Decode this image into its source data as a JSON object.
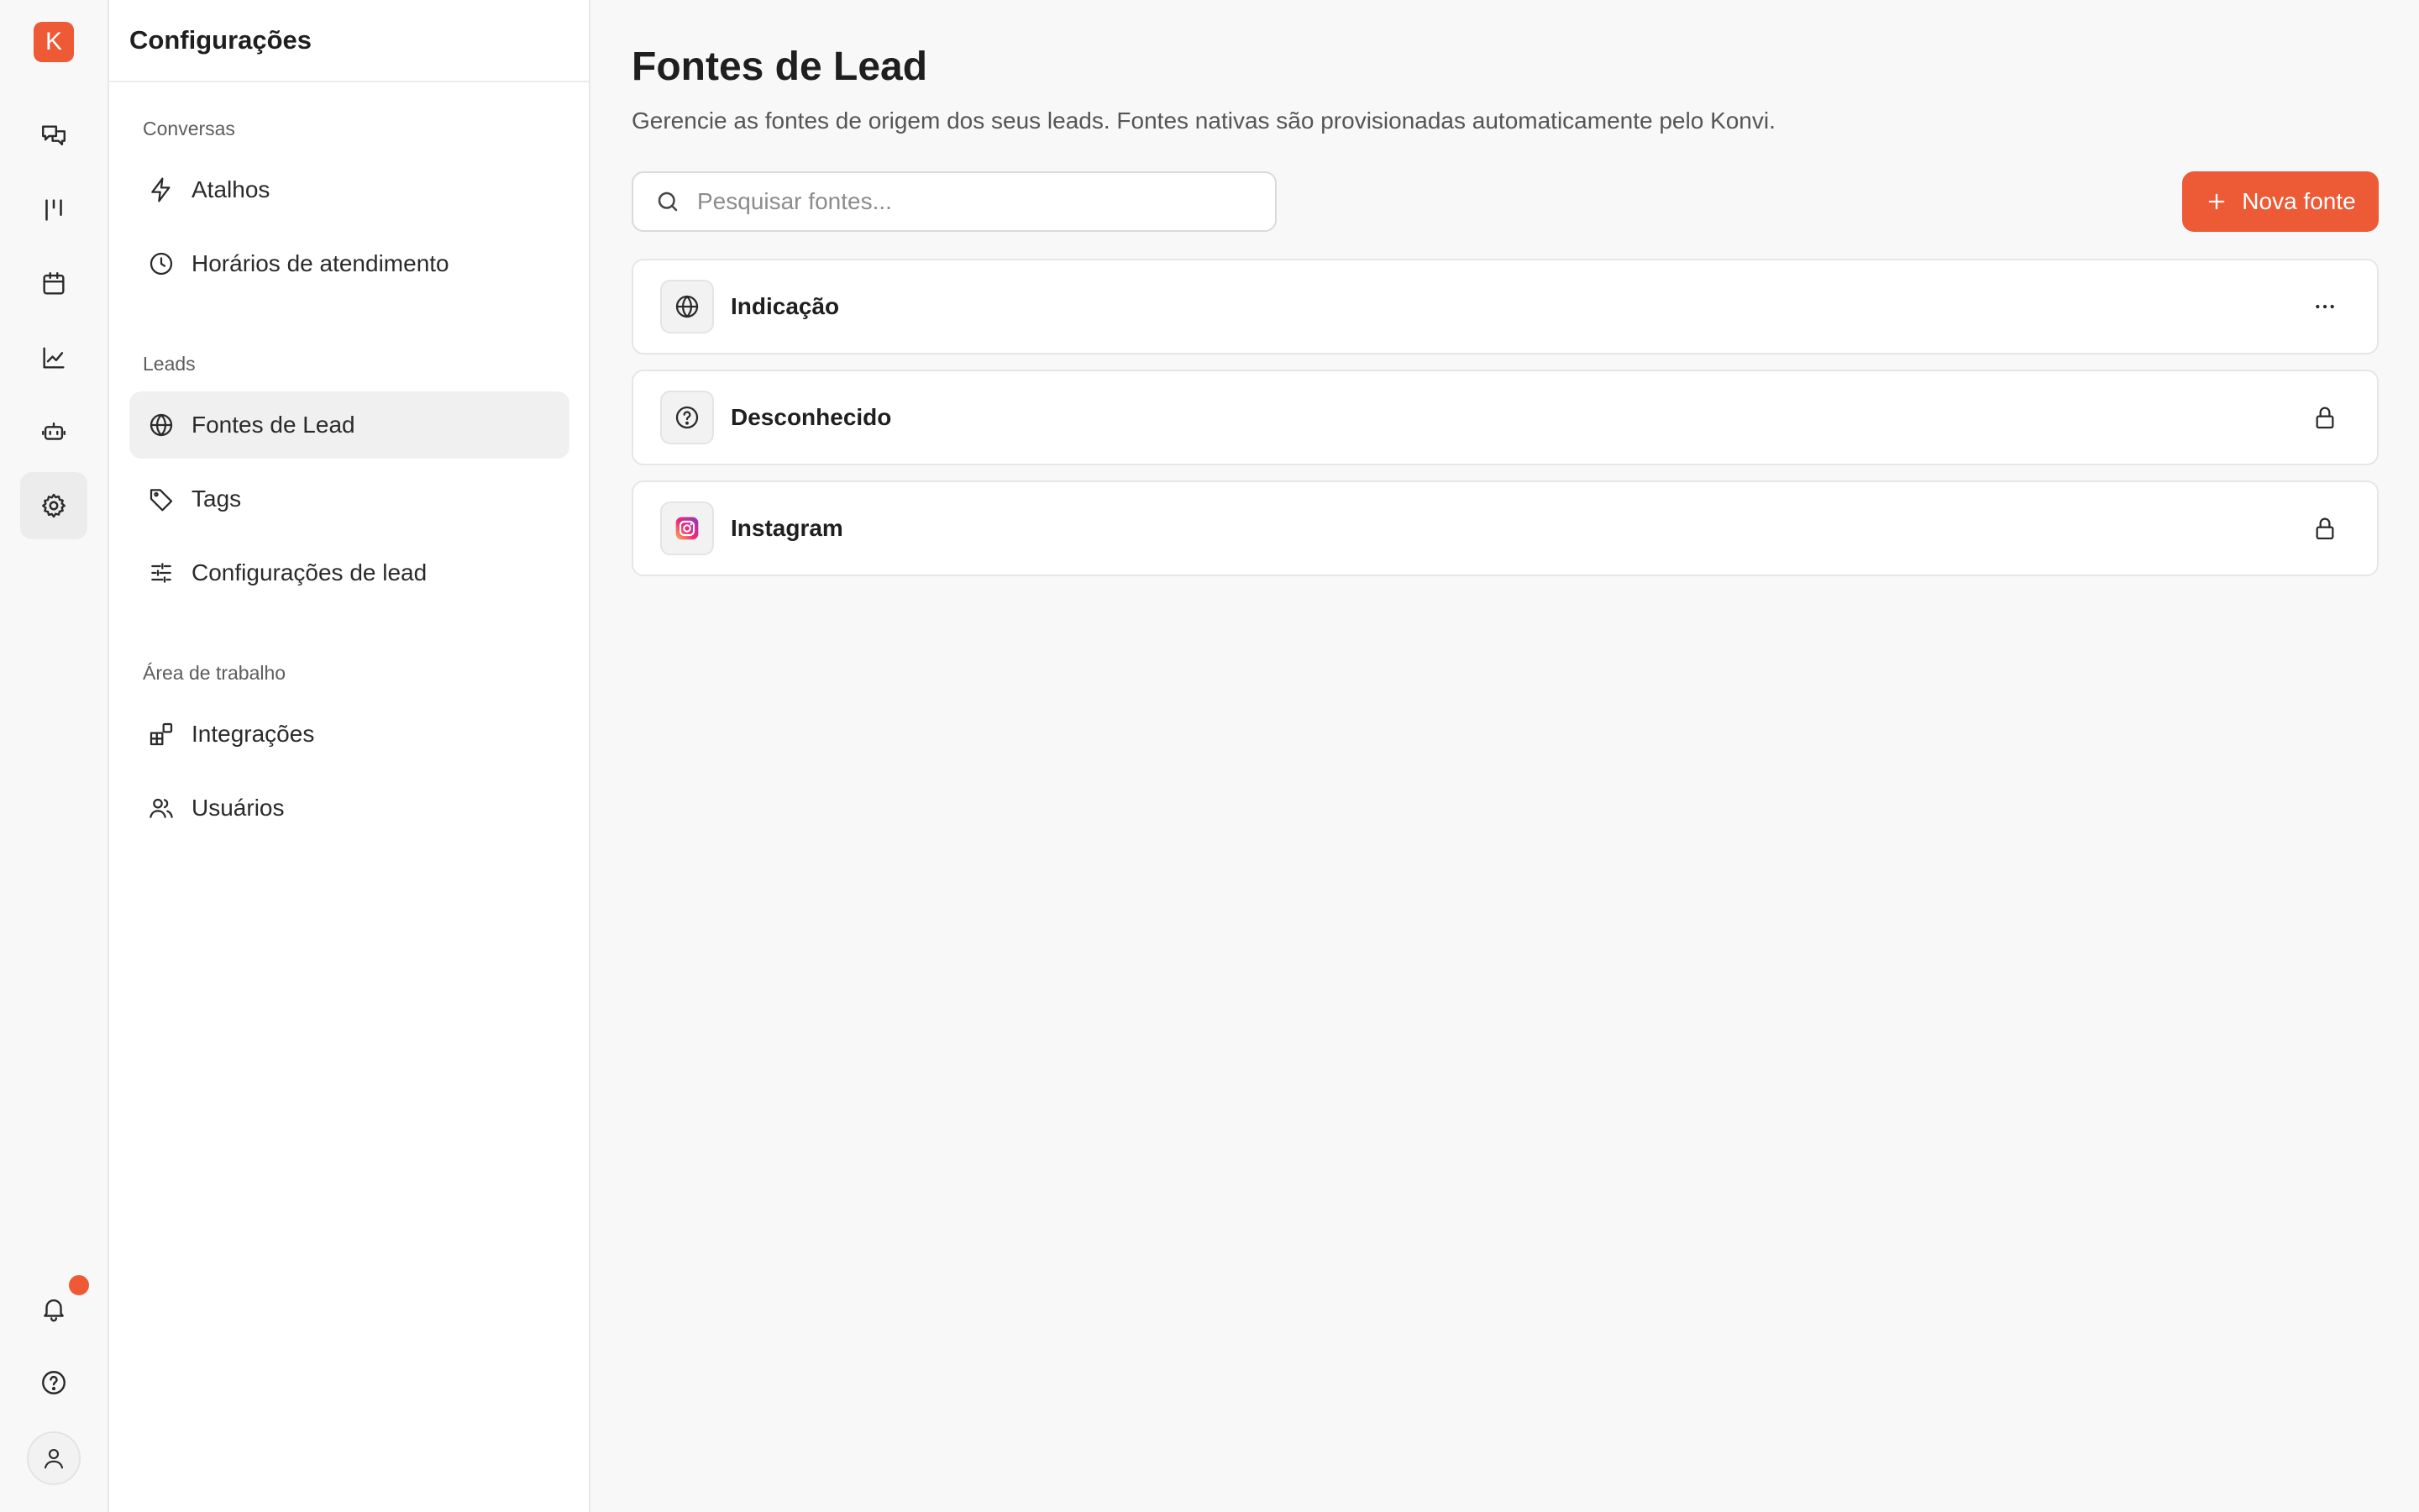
{
  "rail": {
    "logo_letter": "K",
    "items": [
      {
        "icon": "chat-icon"
      },
      {
        "icon": "kanban-icon"
      },
      {
        "icon": "calendar-icon"
      },
      {
        "icon": "chart-icon"
      },
      {
        "icon": "bot-icon"
      },
      {
        "icon": "gear-icon",
        "active": true
      }
    ],
    "bottom": [
      "bell-icon",
      "help-icon",
      "user-icon"
    ]
  },
  "sidebar": {
    "title": "Configurações",
    "sections": [
      {
        "label": "Conversas",
        "items": [
          {
            "label": "Atalhos",
            "icon": "lightning-icon"
          },
          {
            "label": "Horários de atendimento",
            "icon": "clock-icon"
          }
        ]
      },
      {
        "label": "Leads",
        "items": [
          {
            "label": "Fontes de Lead",
            "icon": "globe-icon",
            "active": true
          },
          {
            "label": "Tags",
            "icon": "tag-icon"
          },
          {
            "label": "Configurações de lead",
            "icon": "sliders-icon"
          }
        ]
      },
      {
        "label": "Área de trabalho",
        "items": [
          {
            "label": "Integrações",
            "icon": "integrations-icon"
          },
          {
            "label": "Usuários",
            "icon": "users-icon"
          }
        ]
      }
    ]
  },
  "main": {
    "title": "Fontes de Lead",
    "subtitle": "Gerencie as fontes de origem dos seus leads. Fontes nativas são provisionadas automaticamente pelo Konvi.",
    "search": {
      "placeholder": "Pesquisar fontes...",
      "value": ""
    },
    "new_button_label": "Nova fonte",
    "sources": [
      {
        "name": "Indicação",
        "icon": "globe-icon",
        "action": "more-icon"
      },
      {
        "name": "Desconhecido",
        "icon": "question-icon",
        "action": "lock-icon"
      },
      {
        "name": "Instagram",
        "icon": "instagram-icon",
        "action": "lock-icon"
      }
    ]
  },
  "colors": {
    "accent": "#ec5a36",
    "background": "#f8f8f8",
    "sidebar_active": "#f0f0f0"
  }
}
